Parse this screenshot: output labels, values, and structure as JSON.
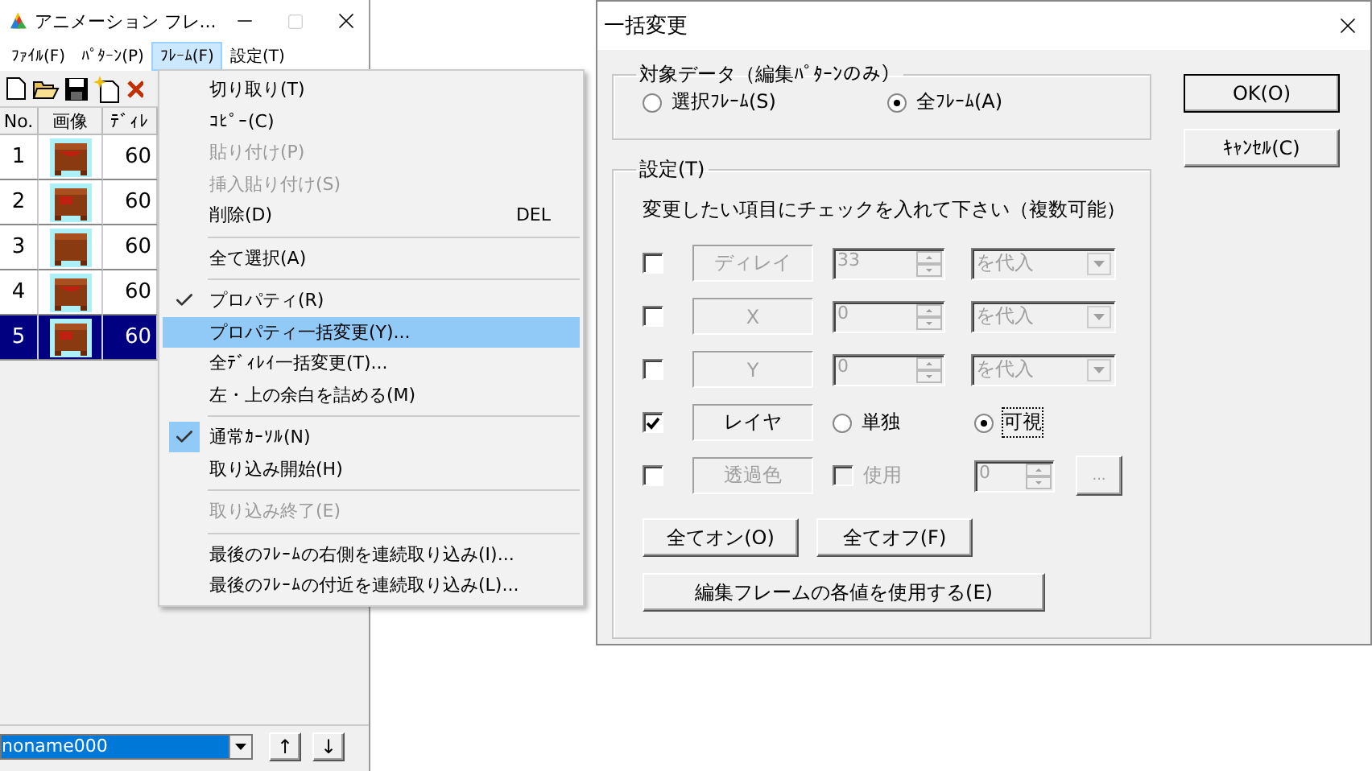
{
  "main_window": {
    "title": "アニメーション フレ...",
    "menu_bar": [
      {
        "label": "ﾌｧｲﾙ(F)",
        "selected": false
      },
      {
        "label": "ﾊﾟﾀｰﾝ(P)",
        "selected": false
      },
      {
        "label": "ﾌﾚｰﾑ(F)",
        "selected": true
      },
      {
        "label": "設定(T)",
        "selected": false
      }
    ],
    "frame_table": {
      "columns": [
        "No.",
        "画像",
        "ﾃﾞｨﾚ"
      ],
      "rows": [
        {
          "number": "1",
          "delay": "60",
          "selected": false
        },
        {
          "number": "2",
          "delay": "60",
          "selected": false
        },
        {
          "number": "3",
          "delay": "60",
          "selected": false
        },
        {
          "number": "4",
          "delay": "60",
          "selected": false
        },
        {
          "number": "5",
          "delay": "60",
          "selected": true
        }
      ]
    },
    "pattern_combo": {
      "value": "noname000"
    },
    "move_buttons": [
      "↑",
      "↓"
    ]
  },
  "frame_menu": {
    "items": [
      {
        "kind": "item",
        "label": "切り取り(T)",
        "checked": false,
        "disabled": false,
        "selected": false
      },
      {
        "kind": "item",
        "label": "ｺﾋﾟｰ(C)",
        "checked": false,
        "disabled": false,
        "selected": false
      },
      {
        "kind": "item",
        "label": "貼り付け(P)",
        "checked": false,
        "disabled": true,
        "selected": false
      },
      {
        "kind": "item",
        "label": "挿入貼り付け(S)",
        "checked": false,
        "disabled": true,
        "selected": false
      },
      {
        "kind": "item",
        "label": "削除(D)",
        "shortcut": "DEL",
        "checked": false,
        "disabled": false,
        "selected": false
      },
      {
        "kind": "separator"
      },
      {
        "kind": "item",
        "label": "全て選択(A)",
        "checked": false,
        "disabled": false,
        "selected": false
      },
      {
        "kind": "separator"
      },
      {
        "kind": "item",
        "label": "プロパティ(R)",
        "checked": true,
        "disabled": false,
        "selected": false
      },
      {
        "kind": "item",
        "label": "プロパティ一括変更(Y)...",
        "checked": false,
        "disabled": false,
        "selected": true
      },
      {
        "kind": "item",
        "label": "全ﾃﾞｨﾚｲ一括変更(T)...",
        "checked": false,
        "disabled": false,
        "selected": false
      },
      {
        "kind": "item",
        "label": "左・上の余白を詰める(M)",
        "checked": false,
        "disabled": false,
        "selected": false
      },
      {
        "kind": "separator"
      },
      {
        "kind": "item",
        "label": "通常ｶｰｿﾙ(N)",
        "checked": true,
        "disabled": false,
        "selected": false
      },
      {
        "kind": "item",
        "label": "取り込み開始(H)",
        "checked": false,
        "disabled": false,
        "selected": false
      },
      {
        "kind": "separator"
      },
      {
        "kind": "item",
        "label": "取り込み終了(E)",
        "checked": false,
        "disabled": true,
        "selected": false
      },
      {
        "kind": "separator"
      },
      {
        "kind": "item",
        "label": "最後のﾌﾚｰﾑの右側を連続取り込み(I)...",
        "checked": false,
        "disabled": false,
        "selected": false
      },
      {
        "kind": "item",
        "label": "最後のﾌﾚｰﾑの付近を連続取り込み(L)...",
        "checked": false,
        "disabled": false,
        "selected": false
      }
    ]
  },
  "dialog": {
    "title": "一括変更",
    "target_group": {
      "title": "対象データ（編集ﾊﾟﾀｰﾝのみ）",
      "options": [
        {
          "label": "選択ﾌﾚｰﾑ(S)",
          "selected": false
        },
        {
          "label": "全ﾌﾚｰﾑ(A)",
          "selected": true
        }
      ]
    },
    "settings_group": {
      "title": "設定(T)",
      "instruction": "変更したい項目にチェックを入れて下さい（複数可能）",
      "rows": [
        {
          "kind": "value",
          "checked": false,
          "label": "ディレイ",
          "value": "33",
          "mode": "を代入"
        },
        {
          "kind": "value",
          "checked": false,
          "label": "X",
          "value": "0",
          "mode": "を代入"
        },
        {
          "kind": "value",
          "checked": false,
          "label": "Y",
          "value": "0",
          "mode": "を代入"
        },
        {
          "kind": "layer",
          "checked": true,
          "label": "レイヤ",
          "options": [
            {
              "label": "単独",
              "selected": false
            },
            {
              "label": "可視",
              "selected": true
            }
          ]
        },
        {
          "kind": "color",
          "checked": false,
          "label": "透過色",
          "use": {
            "label": "使用",
            "checked": false
          },
          "value": "0",
          "button": "..."
        }
      ],
      "toggle_buttons": [
        "全てオン(O)",
        "全てオフ(F)"
      ],
      "apply_button": "編集フレームの各値を使用する(E)"
    },
    "buttons": [
      "OK(O)",
      "ｷｬﾝｾﾙ(C)"
    ]
  }
}
